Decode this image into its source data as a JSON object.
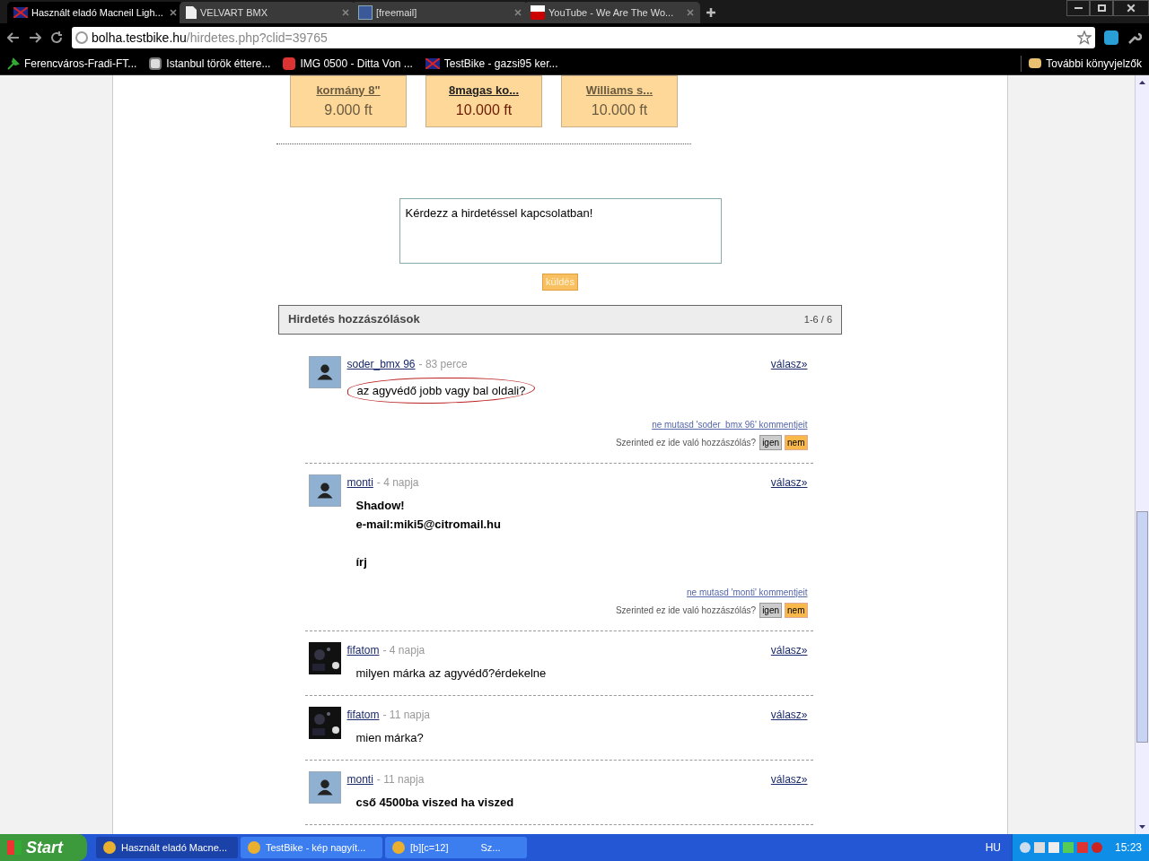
{
  "tabs": [
    {
      "title": "Használt eladó Macneil Ligh...",
      "selected": true
    },
    {
      "title": "VELVART BMX",
      "selected": false
    },
    {
      "title": "[freemail]",
      "selected": false
    },
    {
      "title": "YouTube - We Are The Wo...",
      "selected": false
    }
  ],
  "address": {
    "host": "bolha.testbike.hu",
    "path": "/hirdetes.php?clid=39765"
  },
  "bookmarks": [
    {
      "title": "Ferencváros-Fradi-FT..."
    },
    {
      "title": "Istanbul török éttere..."
    },
    {
      "title": "IMG 0500 - Ditta Von ..."
    },
    {
      "title": "TestBike - gazsi95 ker..."
    }
  ],
  "other_bookmarks": "További könyvjelzők",
  "products": [
    {
      "title": "kormány 8\"",
      "price": "9.000 ft",
      "selected": false
    },
    {
      "title": "8magas ko...",
      "price": "10.000 ft",
      "selected": true
    },
    {
      "title": "Williams s...",
      "price": "10.000 ft",
      "selected": false
    }
  ],
  "question": {
    "placeholder": "Kérdezz a hirdetéssel kapcsolatban!",
    "send": "küldés"
  },
  "comments_header": {
    "title": "Hirdetés hozzászólások",
    "count": "1-6 / 6"
  },
  "comments": [
    {
      "author": "soder_bmx 96",
      "time": "- 83 perce",
      "kind": "avatar",
      "reply": "válasz»",
      "paragraphs": [
        [
          "az agyvédő jobb vagy bal oldali?"
        ]
      ],
      "bold": false,
      "highlighted": true,
      "hide_link": "ne mutasd 'soder_bmx 96' kommentjeit",
      "vote_question": "Szerinted ez ide való hozzászólás?",
      "yes": "igen",
      "no": "nem"
    },
    {
      "author": "monti",
      "time": "- 4 napja",
      "kind": "avatar",
      "reply": "válasz»",
      "paragraphs": [
        [
          "Shadow!",
          "e-mail:miki5@citromail.hu"
        ],
        [
          "írj"
        ]
      ],
      "bold": true,
      "highlighted": false,
      "hide_link": "ne mutasd 'monti' kommentjeit",
      "vote_question": "Szerinted ez ide való hozzászólás?",
      "yes": "igen",
      "no": "nem"
    },
    {
      "author": "fifatom",
      "time": "- 4 napja",
      "kind": "picture",
      "reply": "válasz»",
      "paragraphs": [
        [
          "milyen márka az agyvédő?érdekelne"
        ]
      ],
      "bold": false,
      "highlighted": false
    },
    {
      "author": "fifatom",
      "time": "- 11 napja",
      "kind": "picture",
      "reply": "válasz»",
      "paragraphs": [
        [
          "mien márka?"
        ]
      ],
      "bold": false,
      "highlighted": false
    },
    {
      "author": "monti",
      "time": "- 11 napja",
      "kind": "avatar",
      "reply": "válasz»",
      "paragraphs": [
        [
          "cső 4500ba viszed ha viszed"
        ]
      ],
      "bold": true,
      "highlighted": false
    }
  ],
  "taskbar": {
    "start": "Start",
    "items": [
      {
        "label": "Használt eladó Macne...",
        "selected": true
      },
      {
        "label": "TestBike - kép nagyít...",
        "selected": false
      },
      {
        "label": "[b][c=12]",
        "suffix": "Sz...",
        "selected": false
      }
    ],
    "language": "HU",
    "clock": "15:23"
  }
}
